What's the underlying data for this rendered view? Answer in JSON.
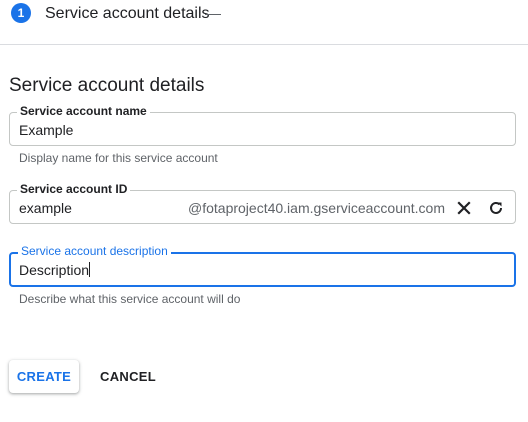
{
  "stepper": {
    "step_number": "1",
    "step_label": "Service account details"
  },
  "form": {
    "title": "Service account details",
    "name_field": {
      "label": "Service account name",
      "value": "Example",
      "hint": "Display name for this service account"
    },
    "id_field": {
      "label": "Service account ID",
      "value": "example",
      "suffix": "@fotaproject40.iam.gserviceaccount.com",
      "clear_icon": "close-icon",
      "refresh_icon": "refresh-icon"
    },
    "description_field": {
      "label": "Service account description",
      "value": "Description",
      "hint": "Describe what this service account will do"
    }
  },
  "actions": {
    "create_label": "CREATE",
    "cancel_label": "CANCEL"
  },
  "colors": {
    "accent": "#1a73e8",
    "text": "#202124",
    "secondary_text": "#5f6368",
    "border": "#c4c7c5"
  }
}
